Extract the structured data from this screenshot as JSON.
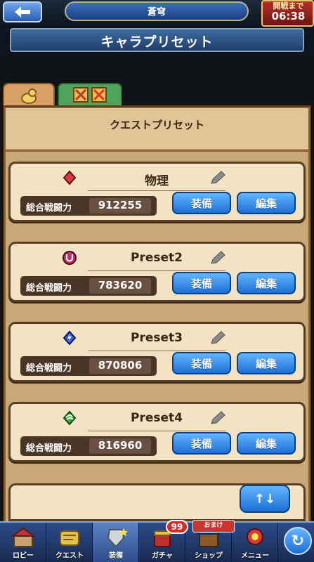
{
  "header": {
    "world_name": "蒼穹",
    "timer_label": "開戦まで",
    "timer_value": "06:38"
  },
  "page": {
    "title": "キャラプリセット"
  },
  "tabs": [
    {
      "icon": "chocobo-icon",
      "active": true
    },
    {
      "icon": "pvp-icon",
      "active": false
    }
  ],
  "panel": {
    "heading": "クエストプリセット"
  },
  "presets": [
    {
      "name": "物理",
      "power_label": "総合戦闘力",
      "power": "912255",
      "equip_label": "装備",
      "edit_label": "編集",
      "icon": "physical-icon",
      "icon_color": "#d93a3a"
    },
    {
      "name": "Preset2",
      "power_label": "総合戦闘力",
      "power": "783620",
      "equip_label": "装備",
      "edit_label": "編集",
      "icon": "magic-icon",
      "icon_color": "#c0306a"
    },
    {
      "name": "Preset3",
      "power_label": "総合戦闘力",
      "power": "870806",
      "equip_label": "装備",
      "edit_label": "編集",
      "icon": "lightning-icon",
      "icon_color": "#3a5fd9"
    },
    {
      "name": "Preset4",
      "power_label": "総合戦闘力",
      "power": "816960",
      "equip_label": "装備",
      "edit_label": "編集",
      "icon": "wind-icon",
      "icon_color": "#3aaa3a"
    }
  ],
  "sort_button": "↑↓",
  "bottom_nav": [
    {
      "label": "ロビー",
      "icon": "lobby-icon"
    },
    {
      "label": "クエスト",
      "icon": "quest-icon"
    },
    {
      "label": "装備",
      "icon": "equipment-icon",
      "active": true
    },
    {
      "label": "ガチャ",
      "icon": "gacha-icon"
    },
    {
      "label": "ショップ",
      "icon": "shop-icon"
    },
    {
      "label": "メニュー",
      "icon": "menu-icon"
    }
  ],
  "badges": {
    "gacha_count": "99",
    "shop_tag": "おまけ"
  },
  "colors": {
    "accent_blue": "#1d6fd6",
    "panel_brown": "#8a6134",
    "card_cream": "#f1e3c3"
  }
}
